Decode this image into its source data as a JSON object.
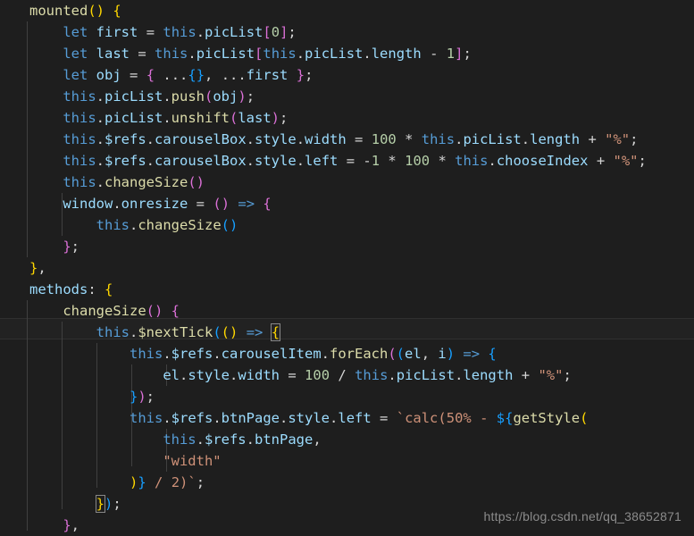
{
  "editor": {
    "theme": "dark-plus",
    "background": "#1e1e1e",
    "active_line_background": "#222222",
    "indent_guide_color": "#404040",
    "font_size_px": 15.5,
    "line_height_px": 24,
    "active_line_number": 16,
    "language": "javascript"
  },
  "colors": {
    "keyword": "#569cd6",
    "function": "#dcdcaa",
    "property": "#9cdcfe",
    "number": "#b5cea8",
    "string": "#ce9178",
    "plain": "#d4d4d4",
    "bracket_gold": "#ffd700",
    "bracket_pink": "#da70d6",
    "bracket_blue": "#179fff"
  },
  "code": {
    "lines": [
      "mounted() {",
      "    let first = this.picList[0];",
      "    let last = this.picList[this.picList.length - 1];",
      "    let obj = { ...{}, ...first };",
      "    this.picList.push(obj);",
      "    this.picList.unshift(last);",
      "    this.$refs.carouselBox.style.width = 100 * this.picList.length + \"%\";",
      "    this.$refs.carouselBox.style.left = -1 * 100 * this.chooseIndex + \"%\";",
      "    this.changeSize()",
      "    window.onresize = () => {",
      "        this.changeSize()",
      "    };",
      "},",
      "methods: {",
      "    changeSize() {",
      "        this.$nextTick(() => {",
      "            this.$refs.carouselItem.forEach((el, i) => {",
      "                el.style.width = 100 / this.picList.length + \"%\";",
      "            });",
      "            this.$refs.btnPage.style.left = `calc(50% - ${getStyle(",
      "                this.$refs.btnPage,",
      "                \"width\"",
      "            )} / 2)`;",
      "        });",
      "    },"
    ]
  },
  "watermark": {
    "text": "https://blog.csdn.net/qq_38652871"
  }
}
